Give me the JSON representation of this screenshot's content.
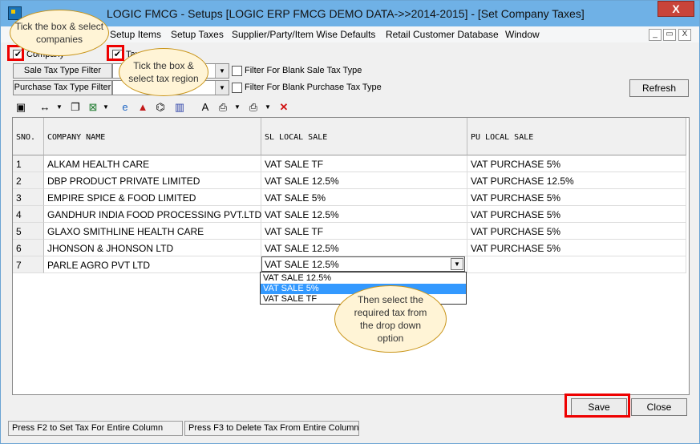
{
  "window": {
    "title": "LOGIC FMCG - Setups  [LOGIC ERP FMCG DEMO DATA->>2014-2015] - [Set Company Taxes]",
    "close_label": "X"
  },
  "menu": [
    {
      "label": "Setup Items"
    },
    {
      "label": "Setup Taxes"
    },
    {
      "label": "Supplier/Party/Item Wise Defaults"
    },
    {
      "label": "Retail Customer Database"
    },
    {
      "label": "Window"
    }
  ],
  "mdi_controls": [
    "_",
    "▭",
    "X"
  ],
  "filters": {
    "company_checkbox_label": "Company",
    "tax_checkbox_label": "Tax",
    "sale_tax_type_filter": "Sale Tax Type Filter",
    "purchase_tax_type_filter": "Purchase Tax Type Filter",
    "blank_sale_tax_label": "Filter For Blank Sale Tax Type",
    "blank_purchase_tax_label": "Filter For Blank Purchase Tax Type",
    "refresh_label": "Refresh"
  },
  "grid": {
    "columns": [
      "SNO.",
      "COMPANY NAME",
      "SL LOCAL SALE",
      "PU LOCAL SALE"
    ],
    "rows": [
      {
        "sno": "1",
        "company": "ALKAM HEALTH CARE",
        "sl": "VAT SALE TF",
        "pu": "VAT PURCHASE 5%"
      },
      {
        "sno": "2",
        "company": "DBP PRODUCT PRIVATE LIMITED",
        "sl": "VAT SALE 12.5%",
        "pu": "VAT PURCHASE 12.5%"
      },
      {
        "sno": "3",
        "company": "EMPIRE SPICE & FOOD LIMITED",
        "sl": "VAT SALE 5%",
        "pu": "VAT PURCHASE 5%"
      },
      {
        "sno": "4",
        "company": "GANDHUR INDIA FOOD PROCESSING PVT.LTD",
        "sl": "VAT SALE 12.5%",
        "pu": "VAT PURCHASE 5%"
      },
      {
        "sno": "5",
        "company": "GLAXO SMITHLINE HEALTH CARE",
        "sl": "VAT SALE TF",
        "pu": "VAT PURCHASE 5%"
      },
      {
        "sno": "6",
        "company": "JHONSON & JHONSON LTD",
        "sl": "VAT SALE 12.5%",
        "pu": "VAT PURCHASE 5%"
      },
      {
        "sno": "7",
        "company": "PARLE AGRO PVT LTD",
        "sl": "",
        "pu": ""
      }
    ]
  },
  "dropdown": {
    "current_value": "VAT SALE 12.5%",
    "options": [
      "VAT SALE 12.5%",
      "VAT SALE 5%",
      "VAT SALE TF"
    ],
    "highlighted_index": 1
  },
  "buttons": {
    "save": "Save",
    "close": "Close"
  },
  "status": {
    "pane1": "Press F2 to Set Tax For Entire Column",
    "pane2": "Press F3 to Delete Tax From Entire Column"
  },
  "callouts": {
    "companies": "Tick the box & select companies",
    "tax_region": "Tick the box & select tax region",
    "dropdown": "Then select the required tax from the drop down option"
  },
  "colors": {
    "titlebar": "#6fb1e6",
    "highlight": "#3399ff",
    "callout_fill": "#fff4d6",
    "callout_border": "#c9951a",
    "annotation_red": "#e00000"
  },
  "toolbar_icons": [
    "save-icon",
    "arrows-icon",
    "copy-icon",
    "excel-icon",
    "browser-icon",
    "up-arrow-icon",
    "binoculars-icon",
    "chart-icon",
    "text-icon",
    "preview-icon",
    "print-icon",
    "delete-icon"
  ]
}
